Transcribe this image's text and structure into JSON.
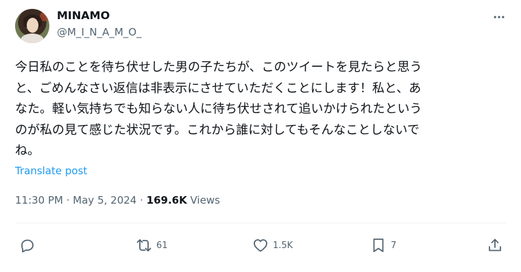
{
  "author": {
    "display_name": "MINAMO",
    "handle": "@M_I_N_A_M_O_"
  },
  "tweet": {
    "text_lines": [
      "今日私のことを待ち伏せした男の子たちが、このツイートを見たらと思う",
      "と、ごめんなさい返信は非表示にさせていただくことにします！私と、あ",
      "なた。軽い気持ちでも知らない人に待ち伏せされて追いかけられたという",
      "のが私の見て感じた状況です。これから誰に対してもそんなことしないで",
      "ね。"
    ],
    "translate_label": "Translate post",
    "time": "11:30 PM",
    "separator": " · ",
    "date": "May 5, 2024",
    "views_count": "169.6K",
    "views_label": " Views"
  },
  "actions": {
    "reply_count": "",
    "retweet_count": "61",
    "like_count": "1.5K",
    "bookmark_count": "7"
  },
  "icons": {
    "more": "more-dots-icon",
    "reply": "reply-bubble-icon",
    "retweet": "retweet-icon",
    "like": "heart-icon",
    "bookmark": "bookmark-icon",
    "share": "share-upload-icon"
  },
  "colors": {
    "text": "#0f1419",
    "secondary": "#536471",
    "link": "#1d9bf0"
  }
}
